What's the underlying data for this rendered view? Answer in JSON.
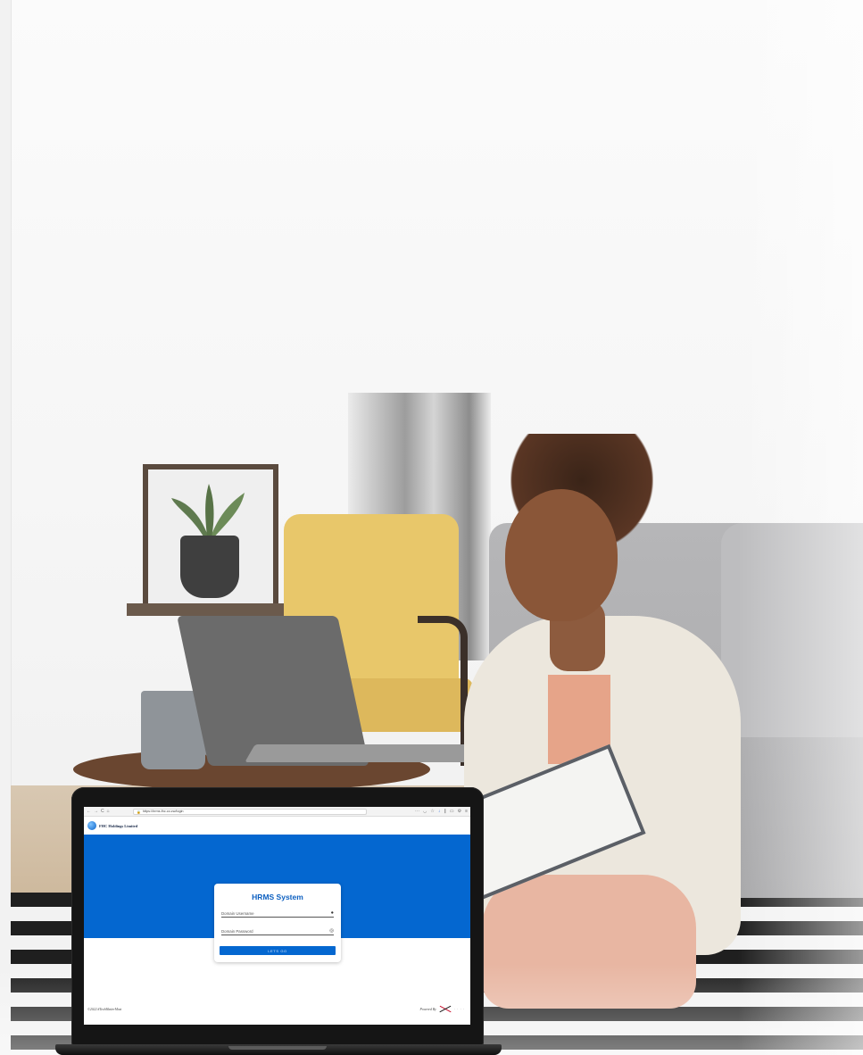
{
  "browser": {
    "nav_icons": [
      "back-icon",
      "forward-icon",
      "reload-icon",
      "home-icon"
    ],
    "url": "https://hrms.fhc.co.zw/login",
    "menu_dots": "···"
  },
  "app": {
    "org_name": "FHC Holdings Limited",
    "title": "HRMS System",
    "username_label": "Domain Username",
    "password_label": "Domain Password",
    "submit_label": "LETS GO",
    "footer_copyright": "©2022 #TechMatterMost",
    "footer_powered": "Powered By"
  },
  "colors": {
    "brand_blue": "#0467d0",
    "title_blue": "#0c5fc0"
  }
}
